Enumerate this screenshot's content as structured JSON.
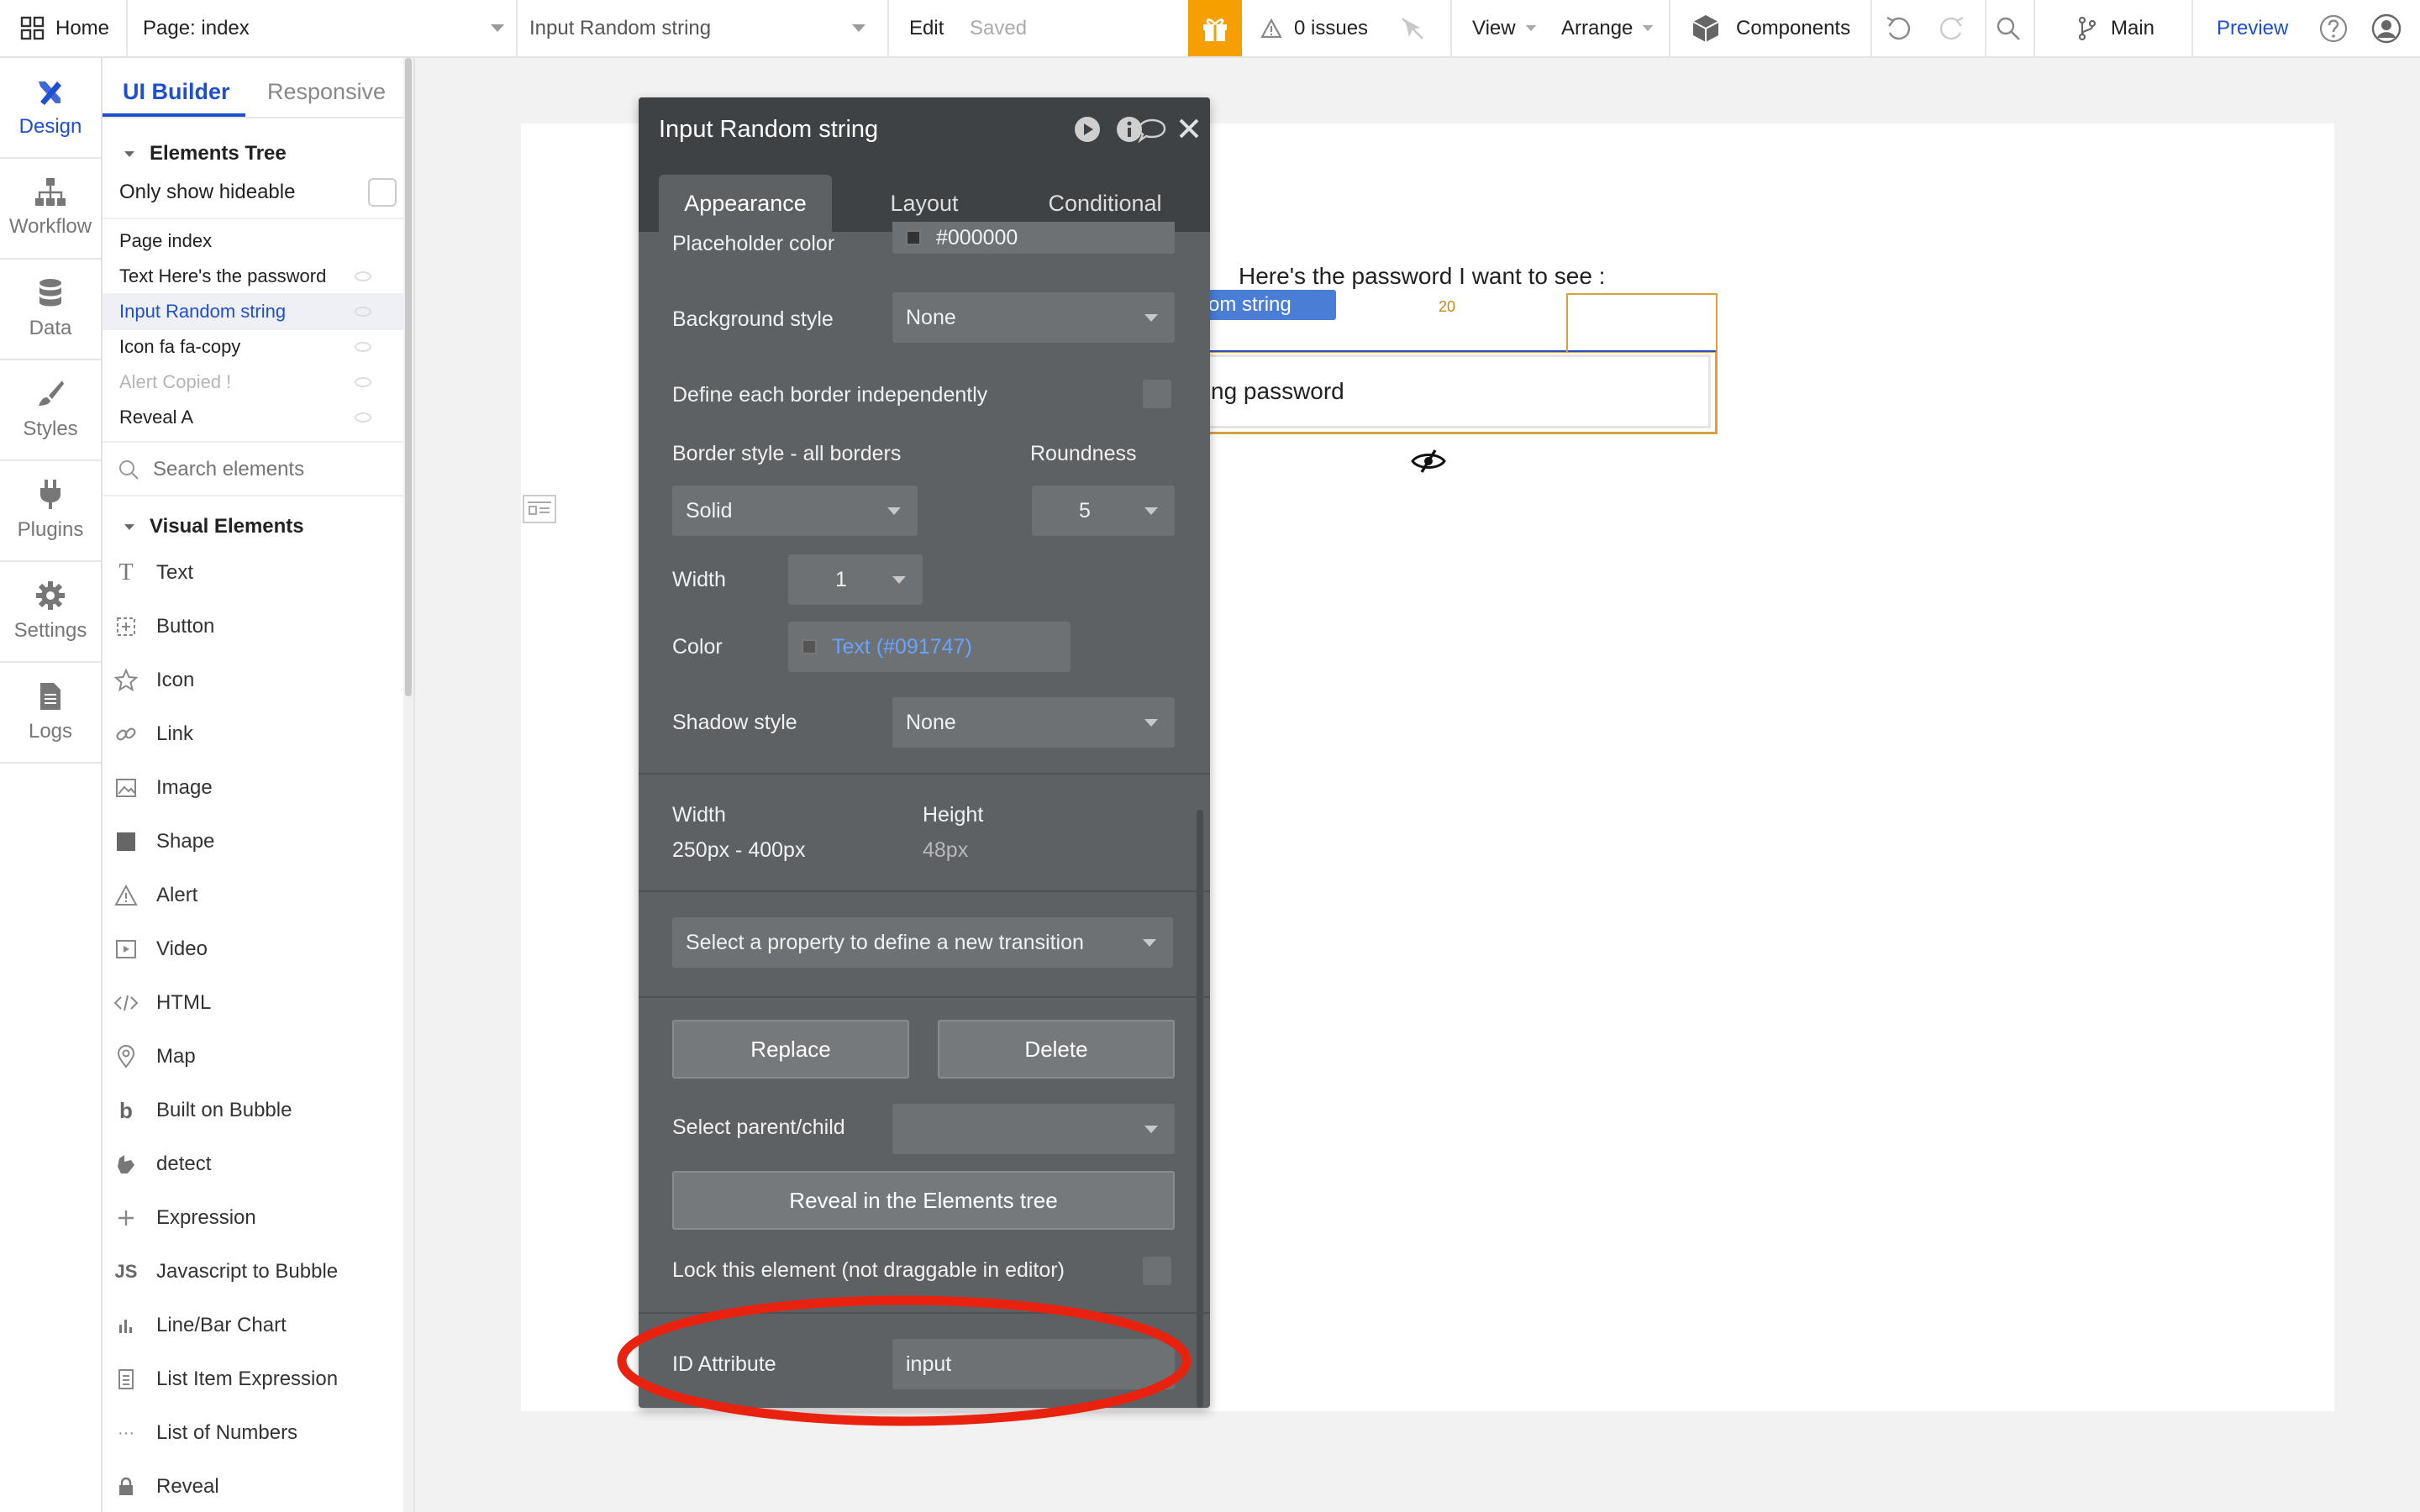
{
  "topbar": {
    "home": "Home",
    "page": "Page: index",
    "element": "Input Random string",
    "edit": "Edit",
    "saved": "Saved",
    "issues": "0 issues",
    "view": "View",
    "arrange": "Arrange",
    "components": "Components",
    "branch": "Main",
    "preview": "Preview"
  },
  "rail": {
    "items": [
      {
        "label": "Design",
        "icon": "design-icon"
      },
      {
        "label": "Workflow",
        "icon": "workflow-icon"
      },
      {
        "label": "Data",
        "icon": "database-icon"
      },
      {
        "label": "Styles",
        "icon": "brush-icon"
      },
      {
        "label": "Plugins",
        "icon": "plug-icon"
      },
      {
        "label": "Settings",
        "icon": "gear-icon"
      },
      {
        "label": "Logs",
        "icon": "document-icon"
      }
    ]
  },
  "panel": {
    "tabs": [
      "UI Builder",
      "Responsive"
    ],
    "tree_title": "Elements Tree",
    "only_hideable": "Only show hideable",
    "tree": [
      "Page index",
      "Text Here's the password",
      "Input Random string",
      "Icon fa fa-copy",
      "Alert Copied !",
      "Reveal A"
    ],
    "search_placeholder": "Search elements",
    "visual_title": "Visual Elements",
    "visual": [
      {
        "label": "Text",
        "icon": "text-icon"
      },
      {
        "label": "Button",
        "icon": "button-icon"
      },
      {
        "label": "Icon",
        "icon": "star-icon"
      },
      {
        "label": "Link",
        "icon": "link-icon"
      },
      {
        "label": "Image",
        "icon": "image-icon"
      },
      {
        "label": "Shape",
        "icon": "square-icon"
      },
      {
        "label": "Alert",
        "icon": "warning-icon"
      },
      {
        "label": "Video",
        "icon": "video-icon"
      },
      {
        "label": "HTML",
        "icon": "code-icon"
      },
      {
        "label": "Map",
        "icon": "map-pin-icon"
      },
      {
        "label": "Built on Bubble",
        "icon": "bubble-logo-icon"
      },
      {
        "label": "detect",
        "icon": "plugin-icon"
      },
      {
        "label": "Expression",
        "icon": "plus-icon"
      },
      {
        "label": "Javascript to Bubble",
        "icon": "js-icon"
      },
      {
        "label": "Line/Bar Chart",
        "icon": "chart-icon"
      },
      {
        "label": "List Item Expression",
        "icon": "list-icon"
      },
      {
        "label": "List of Numbers",
        "icon": "dots-icon"
      },
      {
        "label": "Reveal",
        "icon": "lock-icon"
      }
    ]
  },
  "canvas": {
    "text": "Here's the password I want to see :",
    "element_tag": "andom string",
    "width_badge": "20",
    "input_value": "ng password"
  },
  "editor": {
    "title": "Input Random string",
    "tabs": [
      "Appearance",
      "Layout",
      "Conditional"
    ],
    "placeholder_color_label": "Placeholder color",
    "placeholder_color_value": "#000000",
    "background_style_label": "Background style",
    "background_style_value": "None",
    "define_border_label": "Define each border independently",
    "border_style_label": "Border style - all borders",
    "roundness_label": "Roundness",
    "border_style_value": "Solid",
    "roundness_value": "5",
    "width_label": "Width",
    "width_value": "1",
    "color_label": "Color",
    "color_value": "Text (#091747)",
    "shadow_label": "Shadow style",
    "shadow_value": "None",
    "dim_width_label": "Width",
    "dim_width_value": "250px - 400px",
    "dim_height_label": "Height",
    "dim_height_value": "48px",
    "transition_value": "Select a property to define a new transition",
    "replace": "Replace",
    "delete": "Delete",
    "parent_child_label": "Select parent/child",
    "reveal_tree": "Reveal in the Elements tree",
    "lock_label": "Lock this element (not draggable in editor)",
    "id_attr_label": "ID Attribute",
    "id_attr_value": "input"
  },
  "colors": {
    "accent_blue": "#1f4fd1",
    "highlight_red": "#e8220f",
    "gift_orange": "#f5a000",
    "editor_bg": "#5e6163",
    "color_link": "#6aa3ff"
  }
}
